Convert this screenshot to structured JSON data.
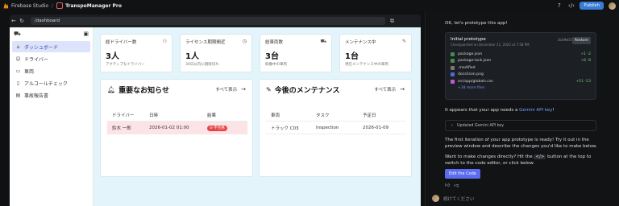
{
  "topbar": {
    "studio_label": "Firebase Studio",
    "separator": "/",
    "project_name": "TranspoManager Pro",
    "publish_label": "Publish",
    "help_icon": "help-icon",
    "code_icon": "code-icon"
  },
  "browser": {
    "url": "/dashboard",
    "back_icon": "←",
    "refresh_icon": "↻",
    "open_icon": "⧉"
  },
  "sidebar": {
    "items": [
      {
        "label": "ダッシュボード",
        "icon": "⌂",
        "active": true
      },
      {
        "label": "ドライバー",
        "icon": "☺",
        "active": false
      },
      {
        "label": "車両",
        "icon": "▭",
        "active": false
      },
      {
        "label": "アルコールチェック",
        "icon": "▯",
        "active": false
      },
      {
        "label": "事故報告書",
        "icon": "▤",
        "active": false
      }
    ]
  },
  "stats": [
    {
      "label": "総ドライバー数",
      "value": "3人",
      "sub": "アクティブなドライバー",
      "icon": "⚇"
    },
    {
      "label": "ライセンス期限間近",
      "value": "1人",
      "sub": "30日以内に期限切れ",
      "icon": "◷"
    },
    {
      "label": "総車両数",
      "value": "3台",
      "sub": "稼働中の車両",
      "icon": "⛟"
    },
    {
      "label": "メンテナンス中",
      "value": "1台",
      "sub": "現在メンテナンス中の車両",
      "icon": "✎"
    }
  ],
  "notices": {
    "title": "重要なお知らせ",
    "view_all": "すべて表示",
    "headers": [
      "ドライバー",
      "日時",
      "結果"
    ],
    "rows": [
      {
        "driver": "鈴木 一郎",
        "datetime": "2026-01-02 01:00",
        "result": "⊘ 不合格"
      }
    ]
  },
  "maintenance": {
    "title": "今後のメンテナンス",
    "view_all": "すべて表示",
    "headers": [
      "車両",
      "タスク",
      "予定日"
    ],
    "rows": [
      {
        "vehicle": "トラック C03",
        "task": "Inspection",
        "date": "2026-01-09"
      }
    ]
  },
  "chat": {
    "intro": "OK, let's prototype this app!",
    "card": {
      "title": "Initial prototype",
      "subtitle": "Checkpointed on December 21, 2025 at 7:58 PM",
      "hash": "3ck9e57",
      "restore_label": "Restore",
      "files": [
        {
          "name": "package.json",
          "diff": "+1 -2",
          "color": "#4a8a52"
        },
        {
          "name": "package-lock.json",
          "diff": "+8 -8",
          "color": "#4a8a52"
        },
        {
          "name": ".modified",
          "diff": "",
          "color": "#777777"
        },
        {
          "name": "docs/icon.png",
          "diff": "",
          "color": "#4f6bd8"
        },
        {
          "name": "src/app/globals.css",
          "diff": "+51 -53",
          "color": "#c05ad0"
        }
      ],
      "more": "+18 more files"
    },
    "gemini_msg_pre": "It appears that your app needs a ",
    "gemini_link": "Gemini API key",
    "gemini_msg_post": "!",
    "gemini_box": "Updated Gemini API key",
    "msg1": "The first iteration of your app prototype is ready! Try it out in the preview window and describe the changes you'd like to make below.",
    "msg2_pre": "Want to make changes directly? Hit the",
    "msg2_code": "</>",
    "msg2_post": "button at the top to switch to the code editor, or click below.",
    "edit_label": "Edit the Code",
    "input_placeholder": "続けてください"
  }
}
